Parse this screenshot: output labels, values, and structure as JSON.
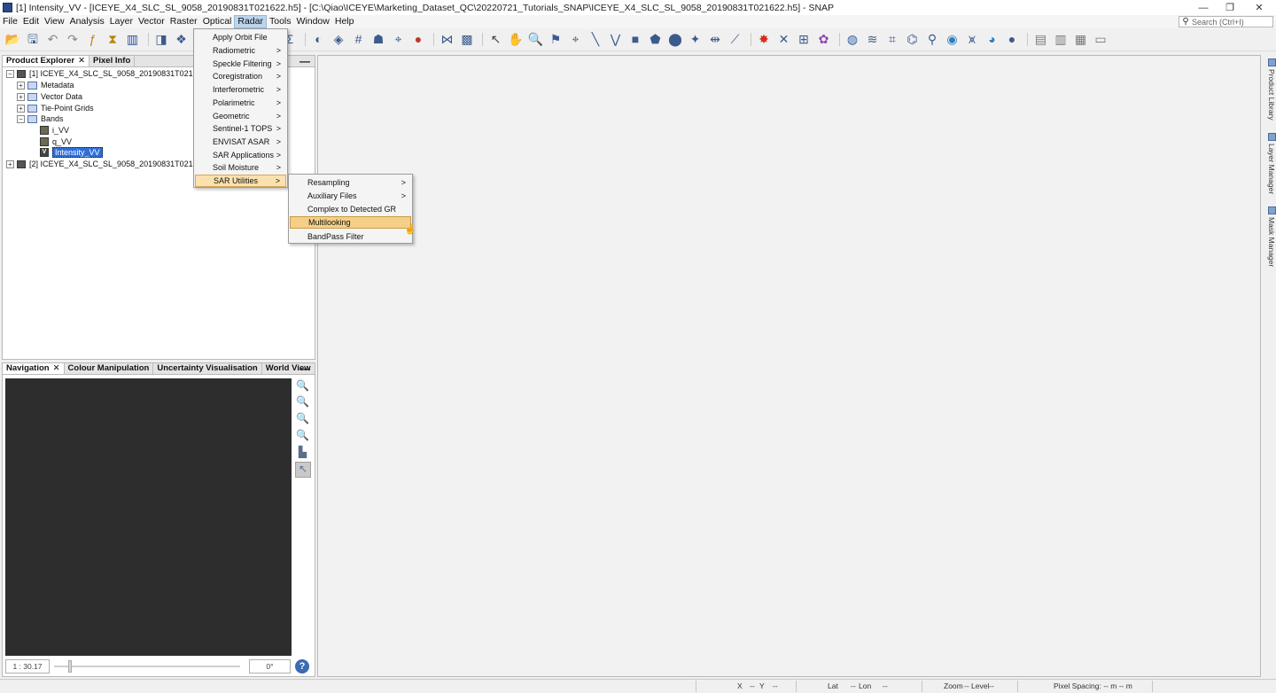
{
  "window": {
    "title": "[1] Intensity_VV - [ICEYE_X4_SLC_SL_9058_20190831T021622.h5] - [C:\\Qiao\\ICEYE\\Marketing_Dataset_QC\\20220721_Tutorials_SNAP\\ICEYE_X4_SLC_SL_9058_20190831T021622.h5] - SNAP",
    "minimize": "—",
    "restore": "❐",
    "close": "✕"
  },
  "menubar": {
    "items": [
      "File",
      "Edit",
      "View",
      "Analysis",
      "Layer",
      "Vector",
      "Raster",
      "Optical",
      "Radar",
      "Tools",
      "Window",
      "Help"
    ],
    "active": "Radar",
    "search_placeholder": "Search (Ctrl+I)"
  },
  "product_explorer": {
    "tabs": [
      "Product Explorer",
      "Pixel Info"
    ],
    "tab_close": "✕",
    "minimize": "—",
    "tree": [
      {
        "label": "[1] ICEYE_X4_SLC_SL_9058_20190831T021622.h5",
        "type": "product",
        "expander": "−"
      },
      {
        "label": "Metadata",
        "type": "folder",
        "expander": "+"
      },
      {
        "label": "Vector Data",
        "type": "folder",
        "expander": "+"
      },
      {
        "label": "Tie-Point Grids",
        "type": "folder",
        "expander": "+"
      },
      {
        "label": "Bands",
        "type": "folder",
        "expander": "−"
      },
      {
        "label": "i_VV",
        "type": "band"
      },
      {
        "label": "q_VV",
        "type": "band"
      },
      {
        "label": "Intensity_VV",
        "type": "band-virtual",
        "selected": true,
        "badge": "V"
      },
      {
        "label": "[2] ICEYE_X4_SLC_SL_9058_20190831T021622.h5_C",
        "type": "product",
        "expander": "+"
      }
    ]
  },
  "navigation": {
    "tabs": [
      "Navigation",
      "Colour Manipulation",
      "Uncertainty Visualisation",
      "World View"
    ],
    "tab_close": "✕",
    "minimize": "—",
    "scale": "1 : 30.17",
    "rotation": "0°",
    "help": "?"
  },
  "radar_menu": {
    "items": [
      {
        "label": "Apply Orbit File",
        "submenu": false
      },
      {
        "label": "Radiometric",
        "submenu": true
      },
      {
        "label": "Speckle Filtering",
        "submenu": true
      },
      {
        "label": "Coregistration",
        "submenu": true
      },
      {
        "label": "Interferometric",
        "submenu": true
      },
      {
        "label": "Polarimetric",
        "submenu": true
      },
      {
        "label": "Geometric",
        "submenu": true
      },
      {
        "label": "Sentinel-1 TOPS",
        "submenu": true
      },
      {
        "label": "ENVISAT ASAR",
        "submenu": true
      },
      {
        "label": "SAR Applications",
        "submenu": true
      },
      {
        "label": "Soil Moisture",
        "submenu": true
      },
      {
        "label": "SAR Utilities",
        "submenu": true,
        "highlighted": true
      }
    ],
    "arrow": ">"
  },
  "sar_utilities_menu": {
    "items": [
      {
        "label": "Resampling",
        "submenu": true
      },
      {
        "label": "Auxiliary Files",
        "submenu": true
      },
      {
        "label": "Complex to Detected GR",
        "submenu": false
      },
      {
        "label": "Multilooking",
        "submenu": false,
        "highlighted": true
      },
      {
        "label": "BandPass Filter",
        "submenu": false
      }
    ],
    "arrow": ">"
  },
  "side_panels": [
    "Product Library",
    "Layer Manager",
    "Mask Manager"
  ],
  "statusbar": {
    "x_label": "X",
    "x_val": "--",
    "y_label": "Y",
    "y_val": "--",
    "lat_label": "Lat",
    "lat_val": "--",
    "lon_label": "Lon",
    "lon_val": "--",
    "zoom_label": "Zoom",
    "zoom_val": "--",
    "level_label": "Level",
    "level_val": "--",
    "pixel_spacing": "Pixel Spacing: -- m -- m"
  },
  "toolbar_icons": [
    "open-product-icon",
    "save-product-icon",
    "undo-icon",
    "redo-icon",
    "band-maths-icon",
    "filter-band-icon",
    "chart-icon",
    "color-manipulation-icon",
    "wind-icon",
    "world-map-icon",
    "statistics-icon",
    "histogram-icon",
    "scatter-plot-icon",
    "sum-icon",
    "mask-icon",
    "layers-icon",
    "grid-icon",
    "profile-icon",
    "gcp-icon",
    "rgb-icon",
    "graph-builder-icon",
    "batch-processing-icon",
    "select-tool-icon",
    "pan-tool-icon",
    "zoom-tool-icon",
    "pin-tool-icon",
    "gcp-tool-icon",
    "line-tool-icon",
    "polyline-tool-icon",
    "rectangle-tool-icon",
    "polygon-tool-icon",
    "ellipse-tool-icon",
    "magic-wand-icon",
    "range-finder-icon",
    "measure-icon",
    "star-icon",
    "cross-icon",
    "toi-icon",
    "flower-icon",
    "globe-icon",
    "time-series-icon",
    "gcp-manager-icon",
    "gcp-chart-icon",
    "search-icon",
    "eye-icon",
    "spectrum-icon",
    "earth-icon",
    "sphere-icon",
    "tile-horizontal-icon",
    "tile-vertical-icon",
    "tile-grid-icon",
    "tile-stack-icon"
  ]
}
